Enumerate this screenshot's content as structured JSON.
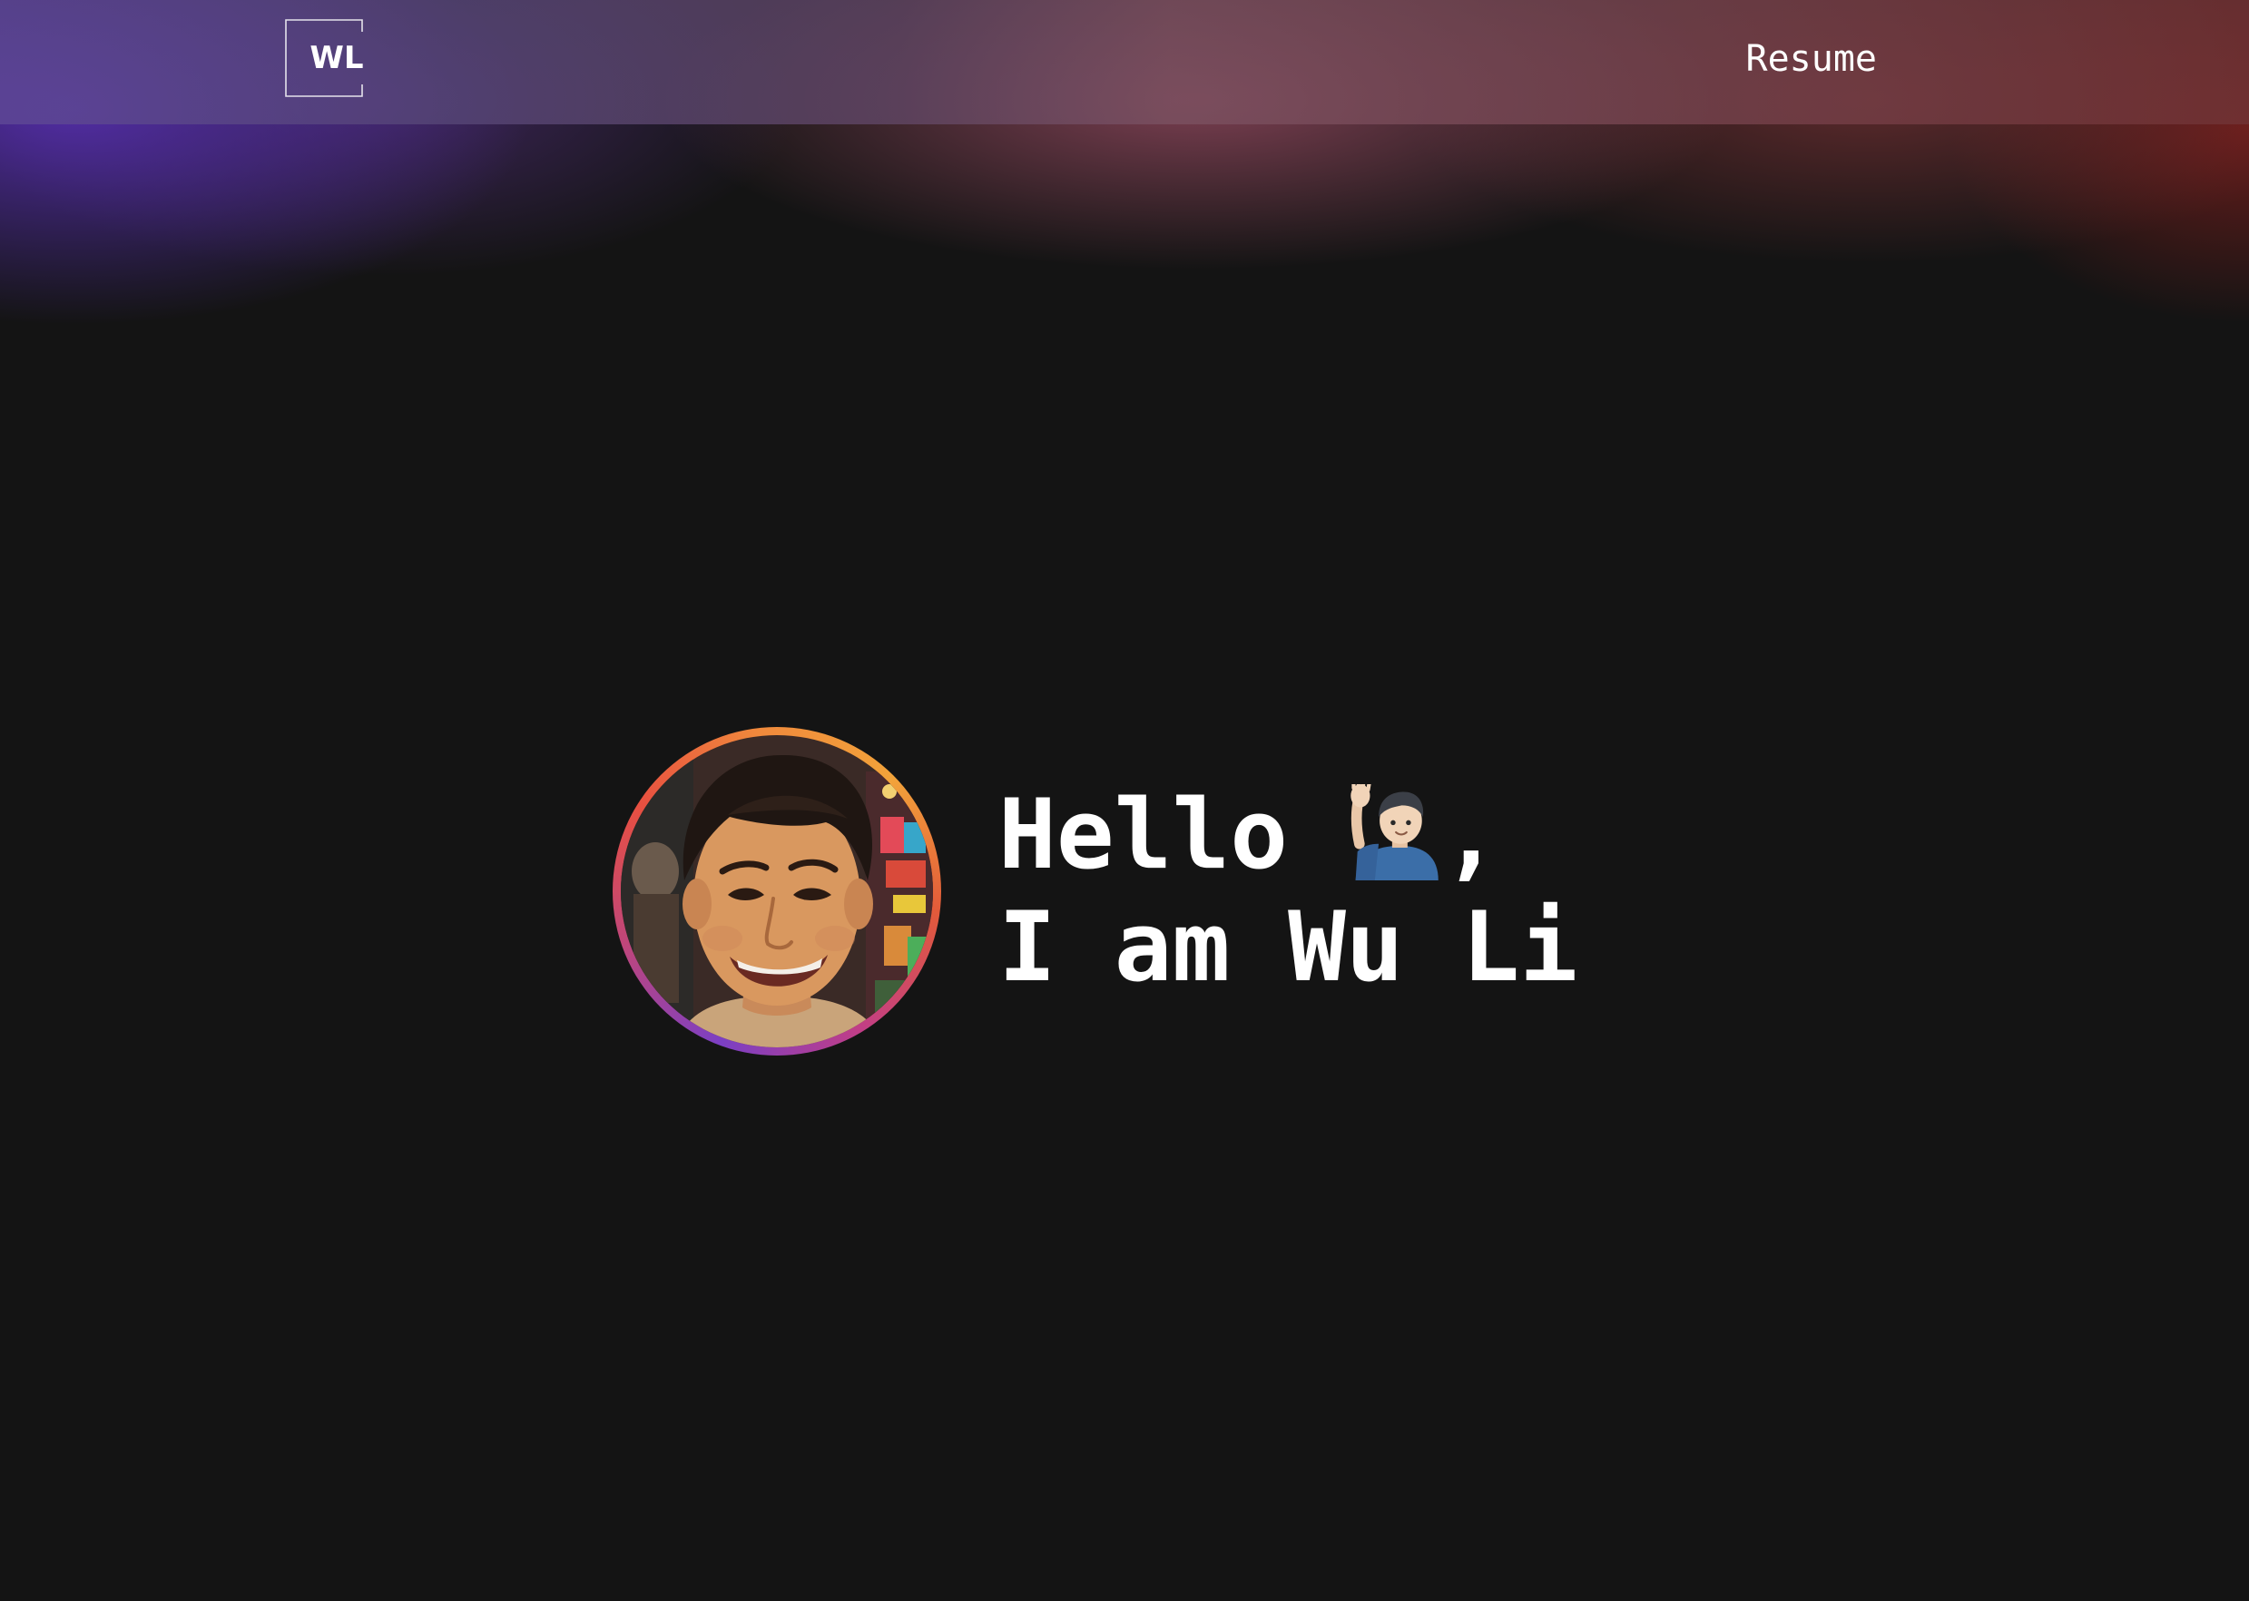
{
  "header": {
    "logo_text": "WL",
    "resume_label": "Resume"
  },
  "hero": {
    "greeting_word": "Hello ",
    "greeting_emoji": "raising-hand-emoji",
    "greeting_suffix": ",",
    "intro_line": "I am Wu Li",
    "avatar": "profile-photo"
  },
  "colors": {
    "background": "#141414",
    "text": "#ffffff",
    "ring_purple": "#7b3fc4",
    "ring_red": "#e85040",
    "ring_orange": "#f2a33a"
  }
}
